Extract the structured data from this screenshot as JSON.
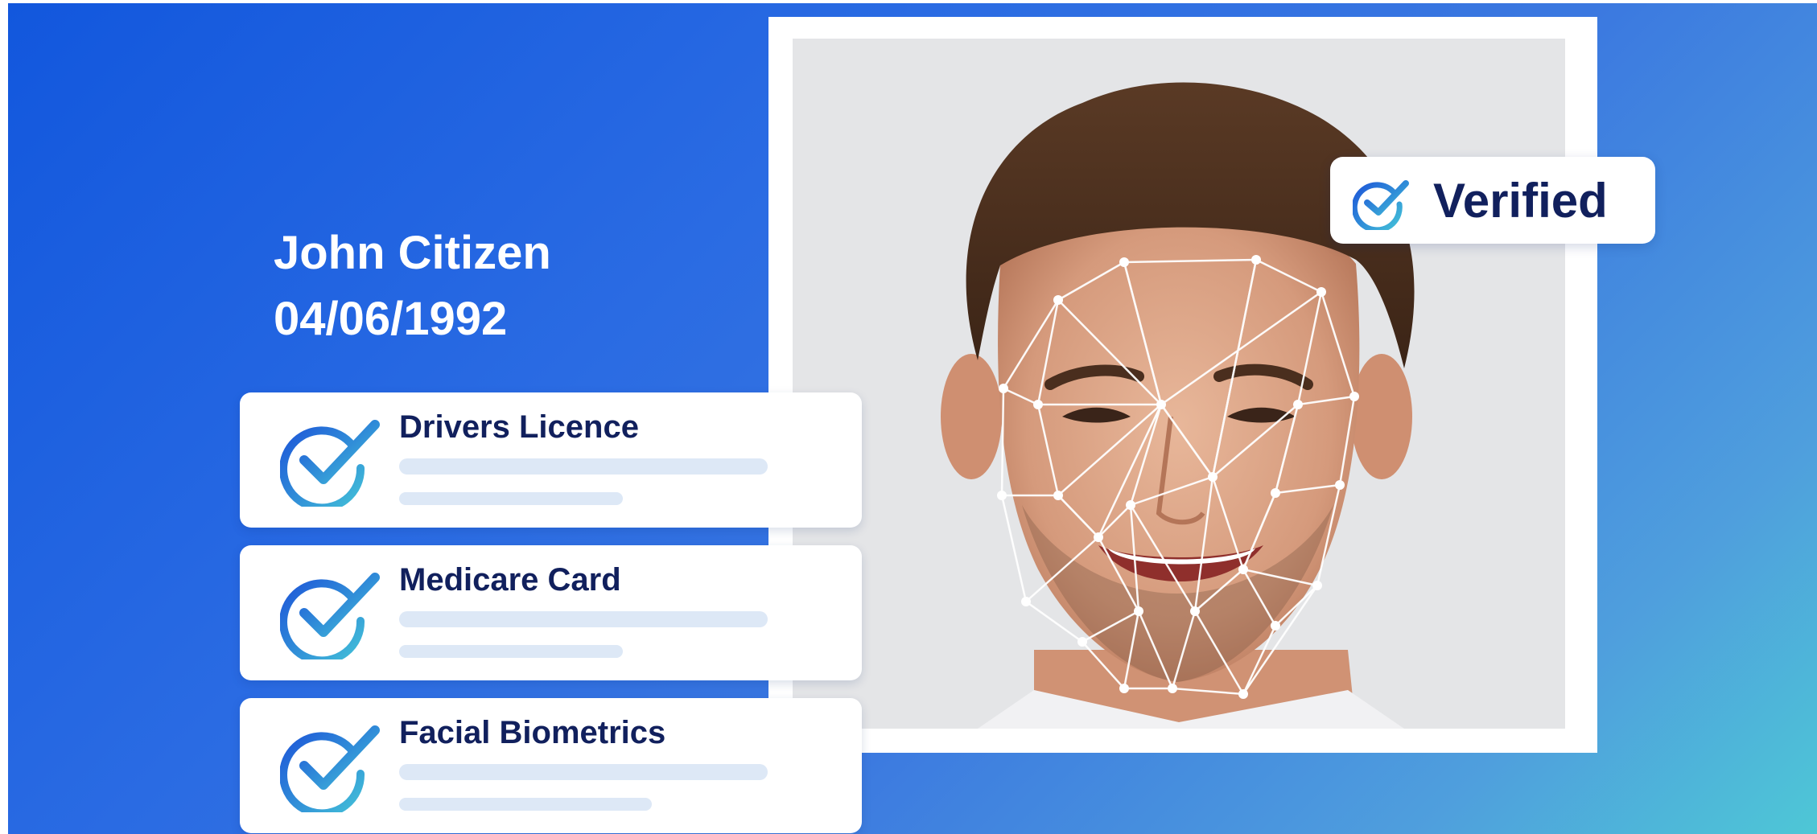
{
  "person": {
    "name": "John Citizen",
    "dob": "04/06/1992"
  },
  "badge": {
    "label": "Verified",
    "icon": "check-circle-icon"
  },
  "checks": [
    {
      "label": "Drivers Licence",
      "icon": "check-circle-icon"
    },
    {
      "label": "Medicare Card",
      "icon": "check-circle-icon"
    },
    {
      "label": "Facial Biometrics",
      "icon": "check-circle-icon"
    }
  ],
  "colors": {
    "background_start": "#1257dd",
    "background_end": "#4ec7d6",
    "text_dark": "#11205d",
    "check_gradient_start": "#1d56d8",
    "check_gradient_end": "#43c2d8",
    "placeholder_bar": "#dde8f6",
    "mesh": "#ffffff"
  }
}
